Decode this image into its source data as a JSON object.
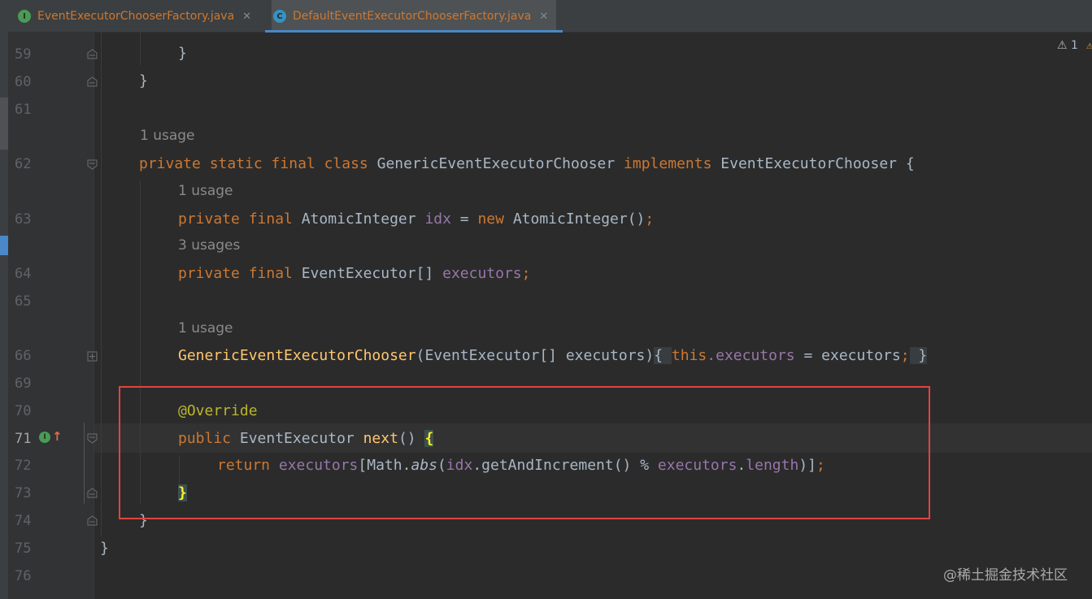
{
  "tabs": [
    {
      "label": "EventExecutorChooserFactory.java",
      "icon": "interface-icon",
      "icon_letter": "I",
      "close": "✕",
      "active": false
    },
    {
      "label": "DefaultEventExecutorChooserFactory.java",
      "icon": "class-icon",
      "icon_letter": "C",
      "close": "✕",
      "active": true
    }
  ],
  "status": {
    "warning_count": "1"
  },
  "gutter": {
    "line_numbers": [
      "59",
      "60",
      "61",
      "62",
      "63",
      "64",
      "65",
      "66",
      "69",
      "70",
      "71",
      "72",
      "73",
      "74",
      "75",
      "76"
    ],
    "current_line": "71",
    "implements_icon_letter": "I",
    "override_arrow": "↑"
  },
  "code": {
    "l59": "}",
    "l60": "}",
    "u62": "1 usage",
    "l62": {
      "kw1": "private static final class ",
      "name": "GenericEventExecutorChooser ",
      "kw2": "implements ",
      "iface": "EventExecutorChooser {"
    },
    "u63": "1 usage",
    "l63": {
      "kw": "private final ",
      "type": "AtomicInteger ",
      "field": "idx",
      "eq": " = ",
      "new": "new ",
      "rest": "AtomicInteger()",
      "semi": ";"
    },
    "u64": "3 usages",
    "l64": {
      "kw": "private final ",
      "type": "EventExecutor[] ",
      "field": "executors",
      "semi": ";"
    },
    "u66": "1 usage",
    "l66": {
      "name": "GenericEventExecutorChooser",
      "params": "(EventExecutor[] executors)",
      "ob": "{ ",
      "this": "this",
      "dot_field": ".executors",
      "assign": " = executors",
      "semi": ";",
      "cb": " }"
    },
    "l70": "@Override",
    "l71": {
      "kw": "public ",
      "type": "EventExecutor ",
      "name": "next",
      "rest": "() ",
      "brace": "{"
    },
    "l72": {
      "kw": "return ",
      "field1": "executors",
      "p1": "[Math.",
      "abs": "abs",
      "p2": "(",
      "field2": "idx",
      "p3": ".getAndIncrement() % ",
      "field3": "executors",
      "p4": ".",
      "field4": "length",
      "p5": ")]",
      "semi": ";"
    },
    "l73": "}",
    "l74": "}",
    "l75": "}"
  },
  "watermark": "@稀土掘金技术社区"
}
